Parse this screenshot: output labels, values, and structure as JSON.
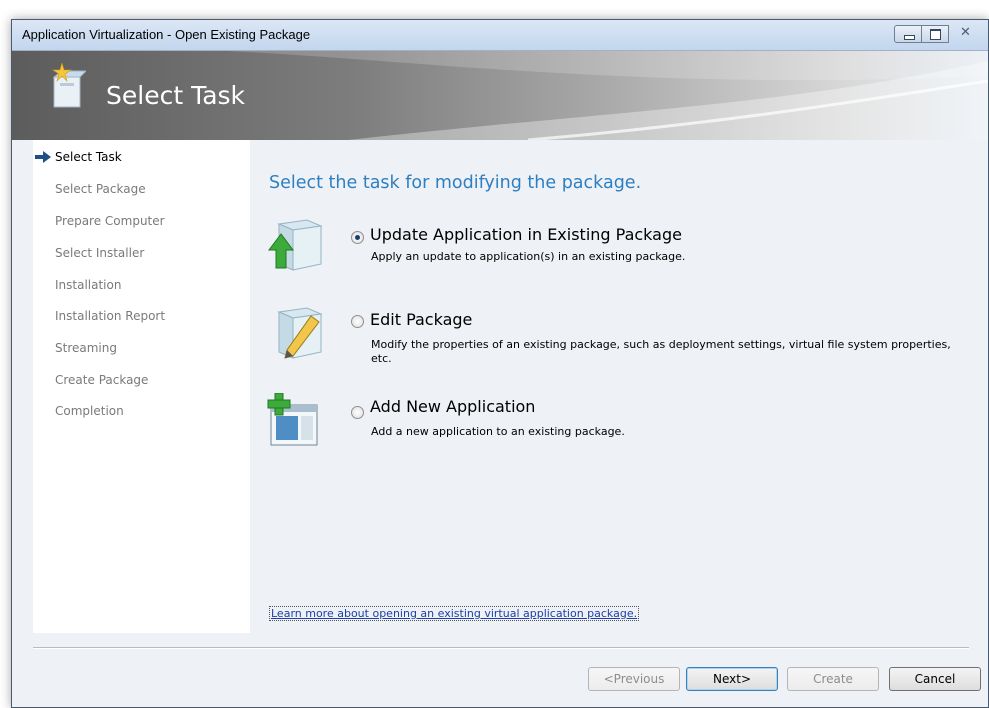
{
  "window": {
    "title": "Application Virtualization - Open Existing Package"
  },
  "banner": {
    "title": "Select Task",
    "icon": "package-sparkle-icon"
  },
  "nav": {
    "items": [
      {
        "label": "Select Task",
        "active": true
      },
      {
        "label": "Select Package",
        "active": false
      },
      {
        "label": "Prepare Computer",
        "active": false
      },
      {
        "label": "Select Installer",
        "active": false
      },
      {
        "label": "Installation",
        "active": false
      },
      {
        "label": "Installation Report",
        "active": false
      },
      {
        "label": "Streaming",
        "active": false
      },
      {
        "label": "Create Package",
        "active": false
      },
      {
        "label": "Completion",
        "active": false
      }
    ]
  },
  "main": {
    "heading": "Select the task for modifying the package.",
    "options": [
      {
        "title": "Update Application in Existing Package",
        "description": "Apply an update to application(s) in an existing package.",
        "selected": true,
        "icon": "package-update-arrow-icon"
      },
      {
        "title": "Edit Package",
        "description": "Modify the properties of an existing package, such as deployment settings, virtual file system properties, etc.",
        "selected": false,
        "icon": "package-edit-pencil-icon"
      },
      {
        "title": "Add New Application",
        "description": "Add a new application to an existing package.",
        "selected": false,
        "icon": "add-application-window-icon"
      }
    ],
    "learn_more": "Learn more about opening an existing virtual application package."
  },
  "buttons": {
    "previous": "<Previous",
    "next": "Next>",
    "create": "Create",
    "cancel": "Cancel"
  },
  "colors": {
    "heading": "#2e7fc1",
    "link": "#1c3fa8",
    "nav_inactive": "#7a7a7a"
  }
}
